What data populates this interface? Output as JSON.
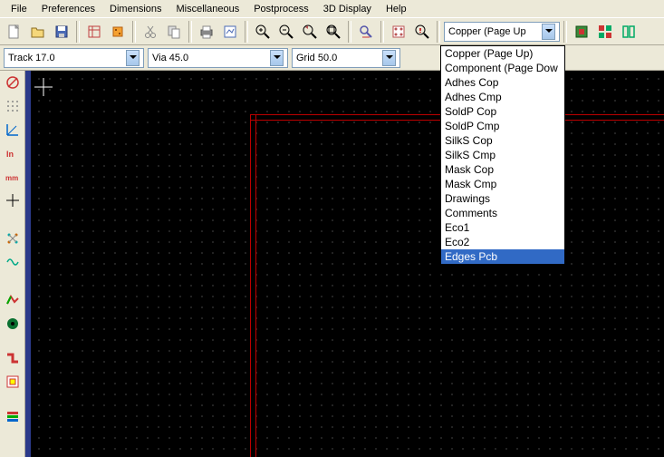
{
  "menu": {
    "items": [
      "File",
      "Preferences",
      "Dimensions",
      "Miscellaneous",
      "Postprocess",
      "3D Display",
      "Help"
    ]
  },
  "toolbar": {
    "layer_combo": "Copper    (Page Up"
  },
  "secondbar": {
    "track": "Track 17.0",
    "via": "Via 45.0",
    "grid": "Grid 50.0"
  },
  "layer_dropdown": {
    "items": [
      "Copper    (Page Up)",
      "Component (Page Dow",
      "Adhes Cop",
      "Adhes Cmp",
      "SoldP Cop",
      "SoldP Cmp",
      "SilkS Cop",
      "SilkS Cmp",
      "Mask Cop",
      "Mask Cmp",
      "Drawings",
      "Comments",
      "Eco1",
      "Eco2",
      "Edges Pcb"
    ],
    "selected_index": 14
  }
}
